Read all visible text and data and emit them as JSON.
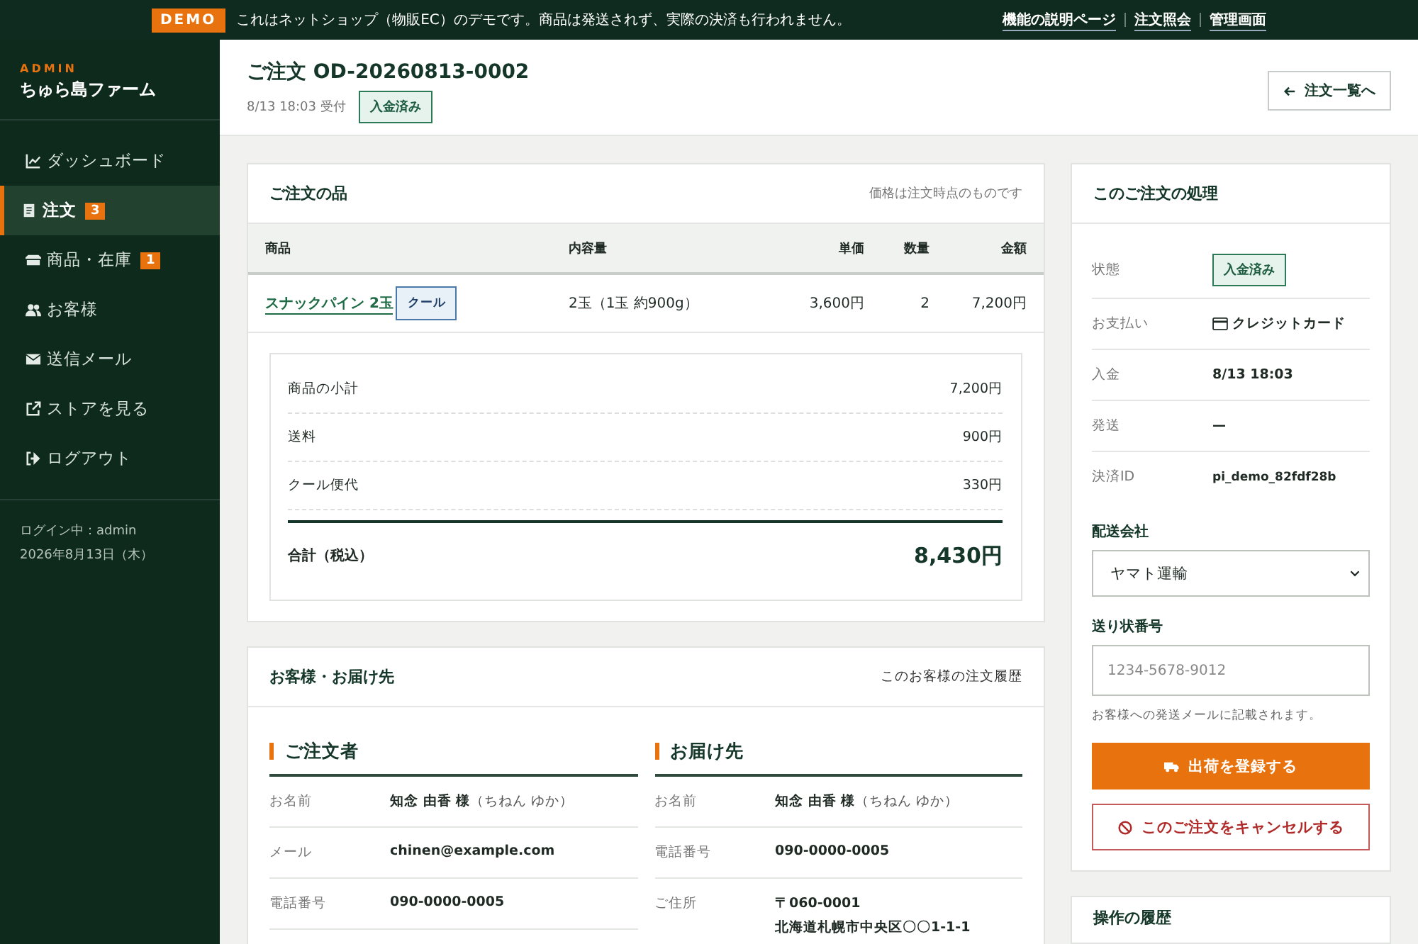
{
  "topbar": {
    "badge": "DEMO",
    "message": "これはネットショップ（物販EC）のデモです。商品は発送されず、実際の決済も行われません。",
    "links": [
      "機能の説明ページ",
      "注文照会",
      "管理画面"
    ]
  },
  "sidebar": {
    "brand_label": "ADMIN",
    "brand_name": "ちゅら島ファーム",
    "items": [
      {
        "label": "ダッシュボード",
        "kind": "chart",
        "selected": false
      },
      {
        "label": "注文",
        "kind": "receipt",
        "badge": "3",
        "selected": true
      },
      {
        "label": "商品・在庫",
        "kind": "box",
        "badge": "1",
        "selected": false
      },
      {
        "label": "お客様",
        "kind": "users",
        "selected": false
      },
      {
        "label": "送信メール",
        "kind": "mail",
        "selected": false
      },
      {
        "label": "ストアを見る",
        "kind": "external",
        "selected": false
      },
      {
        "label": "ログアウト",
        "kind": "logout",
        "selected": false
      }
    ],
    "footer": [
      "ログイン中：admin",
      "2026年8月13日（木）"
    ]
  },
  "header": {
    "title": "ご注文 OD-20260813-0002",
    "received": "8/13 18:03 受付",
    "status": "入金済み",
    "back_button": "注文一覧へ"
  },
  "items_card": {
    "title": "ご注文の品",
    "note": "価格は注文時点のものです",
    "columns": [
      "商品",
      "内容量",
      "単価",
      "数量",
      "金額"
    ],
    "rows": [
      {
        "product": "スナックパイン 2玉",
        "tag": "クール",
        "amount": "2玉（1玉 約900g）",
        "price": "3,600円",
        "qty": "2",
        "total": "7,200円"
      }
    ],
    "summary": [
      {
        "label": "商品の小計",
        "value": "7,200円"
      },
      {
        "label": "送料",
        "value": "900円"
      },
      {
        "label": "クール便代",
        "value": "330円"
      }
    ],
    "total_label": "合計（税込）",
    "total_value": "8,430円"
  },
  "customer_card": {
    "title": "お客様・お届け先",
    "link": "このお客様の注文履歴",
    "sections": [
      {
        "heading": "ご注文者",
        "fields": [
          {
            "label": "お名前",
            "value": "知念 由香 様",
            "reading": "（ちねん ゆか）"
          },
          {
            "label": "メール",
            "value": "chinen@example.com"
          },
          {
            "label": "電話番号",
            "value": "090-0000-0005"
          }
        ]
      },
      {
        "heading": "お届け先",
        "fields": [
          {
            "label": "お名前",
            "value": "知念 由香 様",
            "reading": "（ちねん ゆか）"
          },
          {
            "label": "電話番号",
            "value": "090-0000-0005"
          },
          {
            "label": "ご住所",
            "value": "〒060-0001",
            "extra": "北海道札幌市中央区〇〇1-1-1"
          }
        ]
      }
    ]
  },
  "process_card": {
    "title": "このご注文の処理",
    "fields": [
      {
        "label": "状態",
        "value": "入金済み",
        "kind": "badge"
      },
      {
        "label": "お支払い",
        "value": "クレジットカード",
        "kind": "payment"
      },
      {
        "label": "入金",
        "value": "8/13 18:03",
        "kind": "text"
      },
      {
        "label": "発送",
        "value": "—",
        "kind": "text"
      },
      {
        "label": "決済ID",
        "value": "pi_demo_82fdf28b",
        "kind": "small"
      }
    ],
    "carrier_label": "配送会社",
    "carrier_value": "ヤマト運輸",
    "tracking_label": "送り状番号",
    "tracking_placeholder": "1234-5678-9012",
    "hint": "お客様への発送メールに記載されます。",
    "ship_button": "出荷を登録する",
    "cancel_button": "このご注文をキャンセルする"
  },
  "history_card": {
    "title": "操作の履歴"
  }
}
